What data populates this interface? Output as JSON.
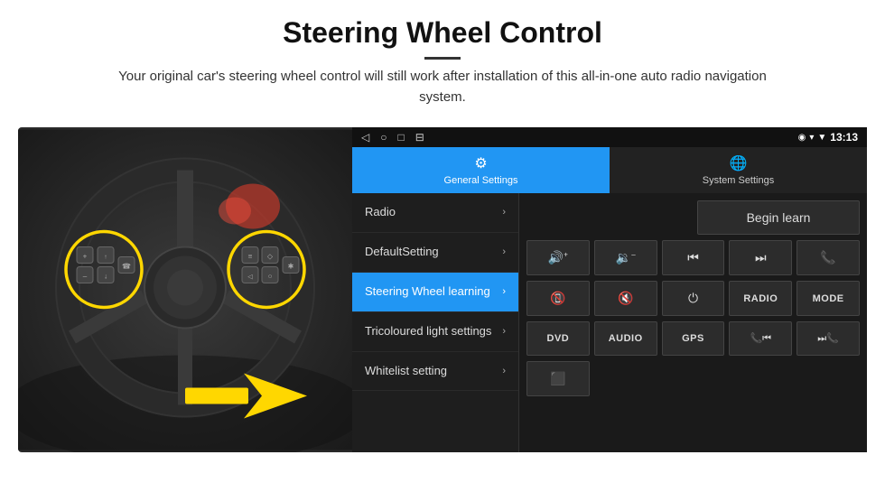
{
  "header": {
    "title": "Steering Wheel Control",
    "description": "Your original car's steering wheel control will still work after installation of this all-in-one auto radio navigation system."
  },
  "status_bar": {
    "time": "13:13",
    "signal": "▼",
    "wifi": "▾",
    "location": "◉"
  },
  "tabs": [
    {
      "id": "general",
      "label": "General Settings",
      "icon": "⚙",
      "active": true
    },
    {
      "id": "system",
      "label": "System Settings",
      "icon": "🌐",
      "active": false
    }
  ],
  "menu_items": [
    {
      "id": "radio",
      "label": "Radio",
      "active": false
    },
    {
      "id": "default",
      "label": "DefaultSetting",
      "active": false
    },
    {
      "id": "steering",
      "label": "Steering Wheel learning",
      "active": true
    },
    {
      "id": "tricoloured",
      "label": "Tricoloured light settings",
      "active": false
    },
    {
      "id": "whitelist",
      "label": "Whitelist setting",
      "active": false
    }
  ],
  "controls": {
    "begin_learn": "Begin learn",
    "row1": [
      {
        "id": "vol_up",
        "icon": "🔊+",
        "label": "vol-up"
      },
      {
        "id": "vol_down",
        "icon": "🔉-",
        "label": "vol-down"
      },
      {
        "id": "prev_track",
        "icon": "⏮",
        "label": "prev-track"
      },
      {
        "id": "next_track",
        "icon": "⏭",
        "label": "next-track"
      },
      {
        "id": "phone",
        "icon": "📞",
        "label": "phone"
      }
    ],
    "row2": [
      {
        "id": "hang_up",
        "icon": "📵",
        "label": "hang-up"
      },
      {
        "id": "mute",
        "icon": "🔇x",
        "label": "mute"
      },
      {
        "id": "power",
        "icon": "⏻",
        "label": "power"
      },
      {
        "id": "radio_btn",
        "text": "RADIO",
        "label": "radio-btn"
      },
      {
        "id": "mode_btn",
        "text": "MODE",
        "label": "mode-btn"
      }
    ],
    "row3": [
      {
        "id": "dvd_btn",
        "text": "DVD",
        "label": "dvd-btn"
      },
      {
        "id": "audio_btn",
        "text": "AUDIO",
        "label": "audio-btn"
      },
      {
        "id": "gps_btn",
        "text": "GPS",
        "label": "gps-btn"
      },
      {
        "id": "phone2",
        "icon": "📞⏮",
        "label": "phone-prev"
      },
      {
        "id": "phone3",
        "icon": "⏭📞",
        "label": "phone-next"
      }
    ],
    "row4_single": {
      "id": "settings_icon",
      "icon": "⬛",
      "label": "settings-icon"
    }
  }
}
